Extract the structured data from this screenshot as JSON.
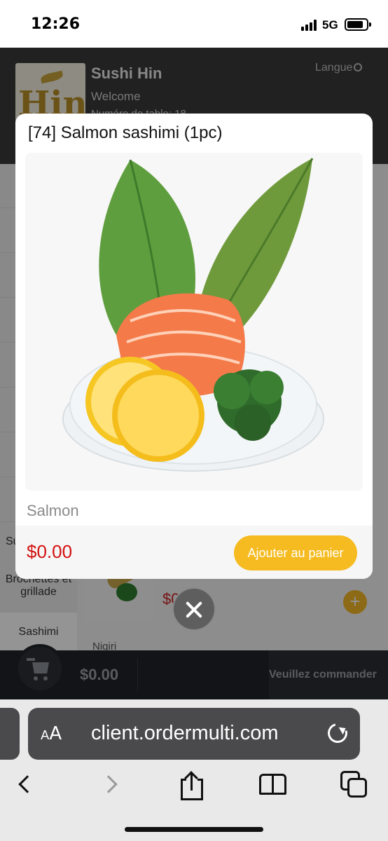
{
  "status_bar": {
    "time": "12:26",
    "network": "5G"
  },
  "header": {
    "restaurant_name": "Sushi Hin",
    "logo_text": "Hin",
    "welcome": "Welcome",
    "table_info": "Numéro de table: 18",
    "language_button": "Langue"
  },
  "sidebar": {
    "categories": [
      "Su",
      "Brochettes et grillade",
      "Sashimi"
    ]
  },
  "background_item": {
    "price": "$0.00",
    "next_section": "Nigiri"
  },
  "cart_bar": {
    "total": "$0.00",
    "order_prompt": "Veuillez commander"
  },
  "modal": {
    "title": "[74] Salmon sashimi (1pc)",
    "description": "Salmon",
    "price": "$0.00",
    "add_to_cart_label": "Ajouter au panier"
  },
  "browser": {
    "text_size_label_small": "A",
    "text_size_label_large": "A",
    "url": "client.ordermulti.com"
  }
}
